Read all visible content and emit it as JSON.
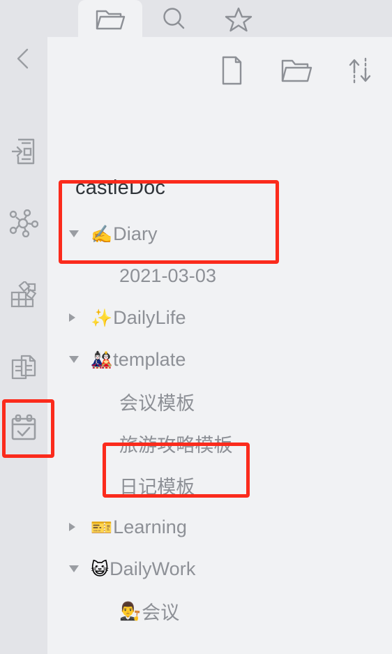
{
  "tabs": [
    {
      "name": "files-tab",
      "icon": "folder-icon",
      "active": true
    },
    {
      "name": "search-tab",
      "icon": "search-icon",
      "active": false
    },
    {
      "name": "favorites-tab",
      "icon": "star-icon",
      "active": false
    }
  ],
  "rail": {
    "back_icon": "chevron-left-icon",
    "items": [
      {
        "name": "sidebar-item-inbox",
        "icon": "inbox-document-icon",
        "selected": false
      },
      {
        "name": "sidebar-item-graph",
        "icon": "graph-network-icon",
        "selected": false
      },
      {
        "name": "sidebar-item-blocks",
        "icon": "blocks-grid-icon",
        "selected": false
      },
      {
        "name": "sidebar-item-documents",
        "icon": "documents-icon",
        "selected": false
      },
      {
        "name": "sidebar-item-calendar",
        "icon": "calendar-check-icon",
        "selected": true
      }
    ]
  },
  "toolbar": {
    "new_doc_icon": "new-document-icon",
    "new_folder_icon": "new-folder-icon",
    "sort_icon": "sort-arrows-icon"
  },
  "notebook": {
    "title": "castleDoc"
  },
  "tree": [
    {
      "level": 0,
      "arrow": "open",
      "emoji": "✍️",
      "emoji_name": "writing-hand-emoji",
      "label": "Diary"
    },
    {
      "level": 1,
      "arrow": "none",
      "emoji": "",
      "emoji_name": "",
      "label": "2021-03-03"
    },
    {
      "level": 0,
      "arrow": "closed",
      "emoji": "✨",
      "emoji_name": "sparkles-emoji",
      "label": "DailyLife"
    },
    {
      "level": 0,
      "arrow": "open",
      "emoji": "🎎",
      "emoji_name": "japanese-dolls-emoji",
      "label": "template"
    },
    {
      "level": 1,
      "arrow": "none",
      "emoji": "",
      "emoji_name": "",
      "label": "会议模板"
    },
    {
      "level": 1,
      "arrow": "none",
      "emoji": "",
      "emoji_name": "",
      "label": "旅游攻略模板"
    },
    {
      "level": 1,
      "arrow": "none",
      "emoji": "",
      "emoji_name": "",
      "label": "日记模板"
    },
    {
      "level": 0,
      "arrow": "closed",
      "emoji": "🎫",
      "emoji_name": "ticket-emoji",
      "label": "Learning"
    },
    {
      "level": 0,
      "arrow": "open",
      "emoji": "😺",
      "emoji_name": "cat-box-emoji",
      "label": "DailyWork"
    },
    {
      "level": 1,
      "arrow": "none",
      "emoji": "👨‍⚖️",
      "emoji_name": "judge-emoji",
      "label": "会议"
    }
  ],
  "highlights": [
    {
      "name": "highlight-sidebar-calendar",
      "color": "#fb2b1c"
    },
    {
      "name": "highlight-diary-folder",
      "color": "#fb2b1c"
    },
    {
      "name": "highlight-riji-template",
      "color": "#fb2b1c"
    }
  ],
  "colors": {
    "accent_red": "#fb2b1c",
    "rail_bg": "#e3e4e8",
    "panel_bg": "#f1f2f4",
    "icon_gray": "#8d9096",
    "title_dark": "#2f3439"
  }
}
